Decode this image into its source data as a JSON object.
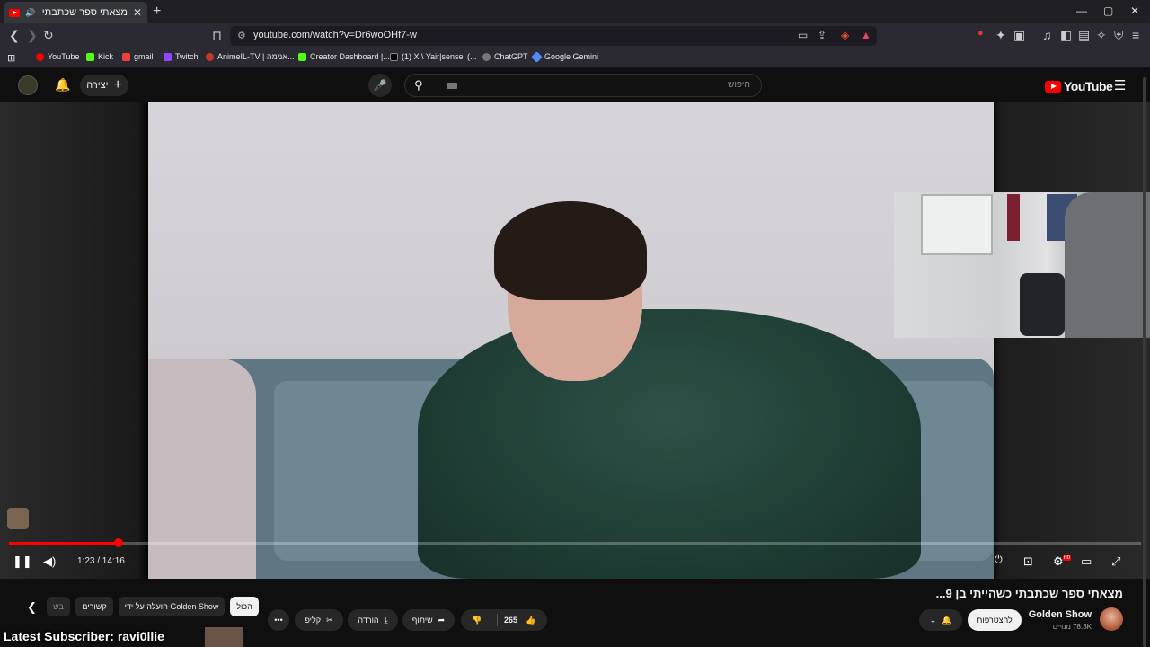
{
  "browser": {
    "tab_title": "מצאתי ספר שכתבתי כשהייתי",
    "tab_close": "✕",
    "new_tab": "+",
    "minimize": "—",
    "maximize": "▢",
    "close": "✕",
    "url": "youtube.com/watch?v=Dr6woOHf7-w"
  },
  "bookmarks": [
    {
      "label": "YouTube",
      "color": "#ff0000"
    },
    {
      "label": "Kick",
      "color": "#53fc18"
    },
    {
      "label": "gmail",
      "color": "#ea4335"
    },
    {
      "label": "Twitch",
      "color": "#9146ff"
    },
    {
      "label": "AnimeIL-TV | אנימה...",
      "color": "#c0392b"
    },
    {
      "label": "Creator Dashboard |...",
      "color": "#53fc18"
    },
    {
      "label": "(1) X \\ Yair|sensei (...",
      "color": "#000000"
    },
    {
      "label": "ChatGPT",
      "color": "#777777"
    },
    {
      "label": "Google Gemini",
      "color": "#4f8df5"
    }
  ],
  "header": {
    "create_label": "יצירה",
    "search_placeholder": "חיפוש",
    "logo_text": "YouTube"
  },
  "player": {
    "current_time": "1:23",
    "duration": "14:16",
    "time_display": "1:23 / 14:16",
    "progress": 0.097,
    "hd_badge": "HD"
  },
  "video": {
    "title": "מצאתי ספר שכתבתי כשהייתי בן 9...",
    "channel_name": "Golden Show",
    "subscribers": "78.3K מנויים",
    "subscribe_label": "להצטרפות",
    "like_count": "265",
    "share_label": "שיתוף",
    "download_label": "הורדה",
    "clip_label": "קליפ"
  },
  "chips": [
    {
      "label": "הכול",
      "active": true
    },
    {
      "label": "הועלה על ידי Golden Show",
      "active": false
    },
    {
      "label": "קשורים",
      "active": false
    },
    {
      "label": "בש",
      "active": false
    }
  ],
  "overlay": {
    "latest_subscriber": "Latest Subscriber: ravi0llie"
  },
  "colors": {
    "accent": "#ff0000",
    "background": "#0f0f0f",
    "chip_bg": "#272727"
  }
}
